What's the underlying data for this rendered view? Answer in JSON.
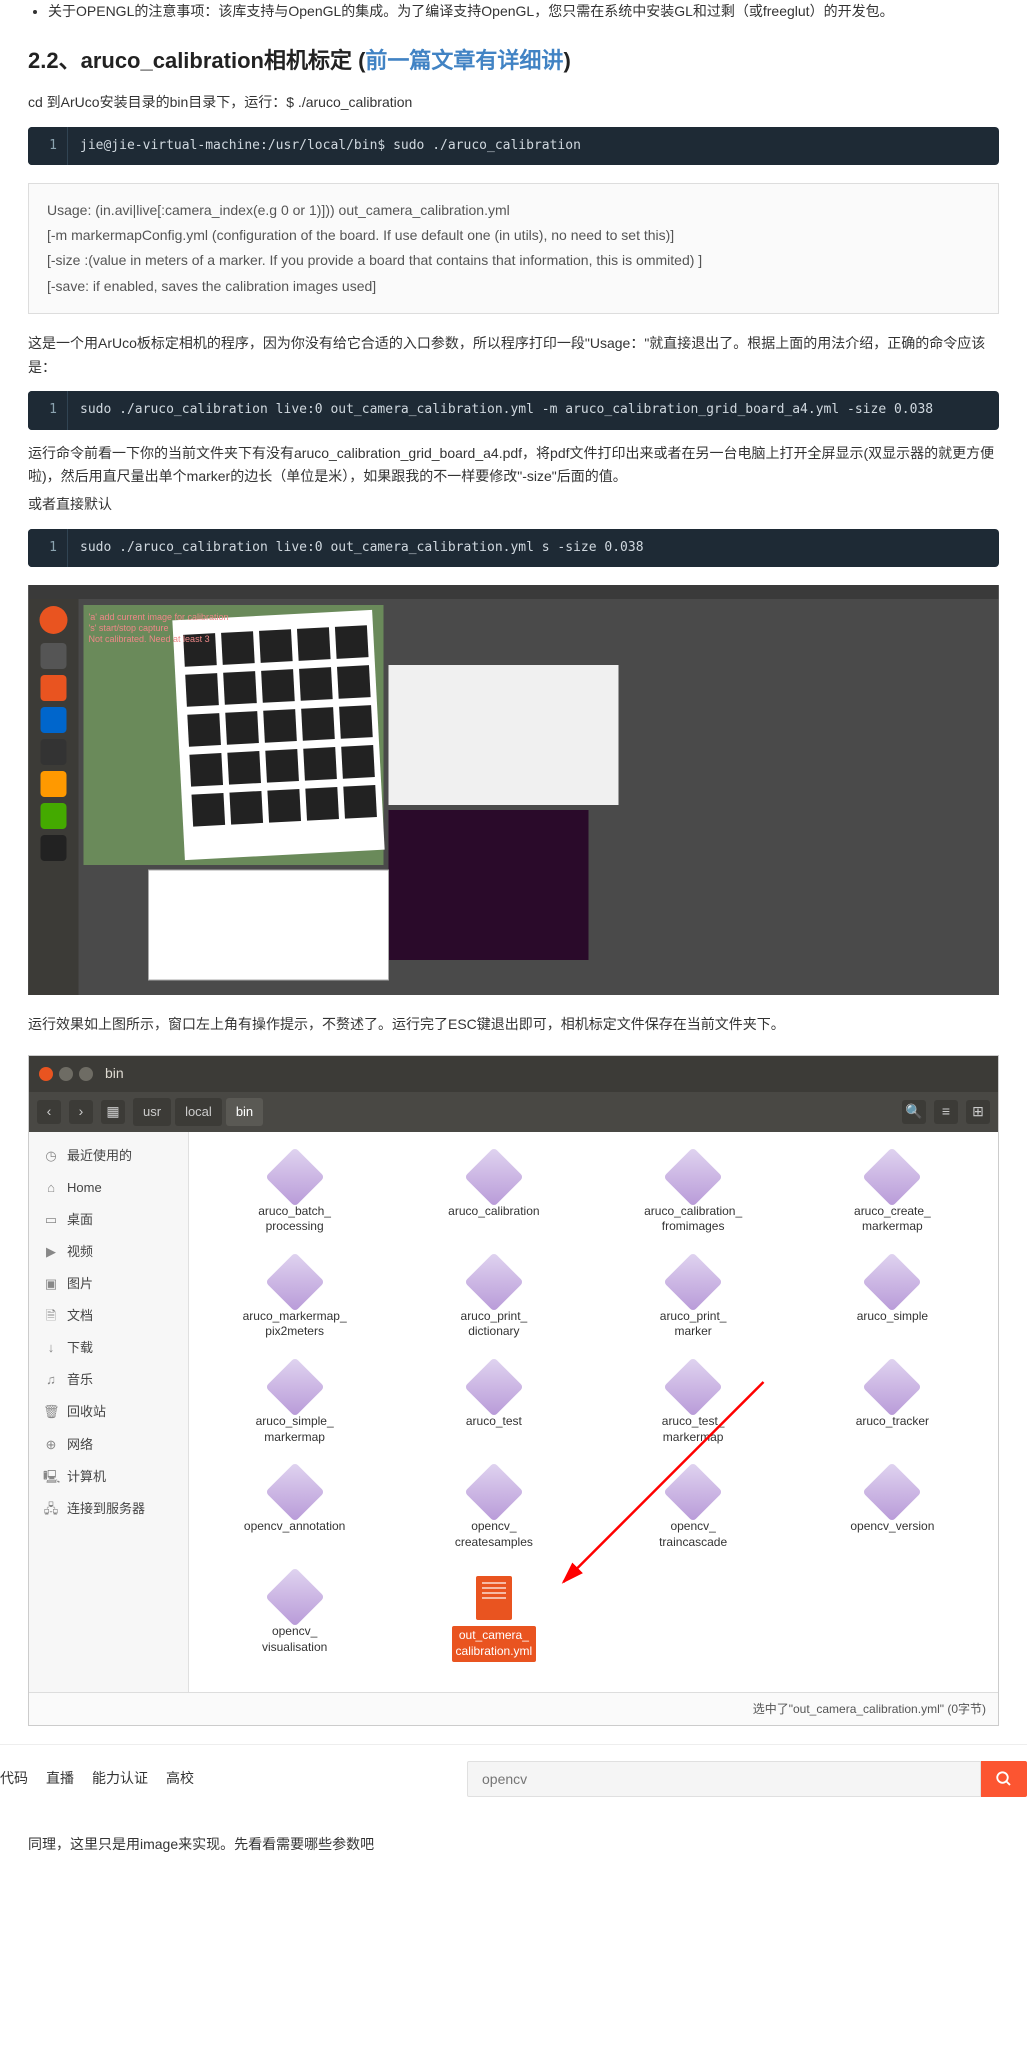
{
  "bullet_opengl": "关于OPENGL的注意事项：该库支持与OpenGL的集成。为了编译支持OpenGL，您只需在系统中安装GL和过剩（或freeglut）的开发包。",
  "h2_prefix": "2.2、aruco_calibration相机标定 (",
  "h2_link": "前一篇文章有详细讲",
  "h2_suffix": ")",
  "p_cd": "cd 到ArUco安装目录的bin目录下，运行：$ ./aruco_calibration",
  "code1": "jie@jie-virtual-machine:/usr/local/bin$ sudo ./aruco_calibration",
  "usage": {
    "l1": "Usage: (in.avi|live[:camera_index(e.g 0 or 1)])) out_camera_calibration.yml",
    "l2": "[-m markermapConfig.yml (configuration of the board. If use default one (in utils), no need to set this)]",
    "l3": "[-size :(value in meters of a marker. If you provide a board that contains that information, this is ommited) ]",
    "l4": "[-save: if enabled, saves the calibration images used]"
  },
  "p_explain": "这是一个用ArUco板标定相机的程序，因为你没有给它合适的入口参数，所以程序打印一段\"Usage：\"就直接退出了。根据上面的用法介绍，正确的命令应该是：",
  "code2": "sudo ./aruco_calibration live:0 out_camera_calibration.yml -m aruco_calibration_grid_board_a4.yml -size 0.038",
  "p_run": "运行命令前看一下你的当前文件夹下有没有aruco_calibration_grid_board_a4.pdf，将pdf文件打印出来或者在另一台电脑上打开全屏显示(双显示器的就更方便啦)，然后用直尺量出单个marker的边长（单位是米），如果跟我的不一样要修改\"-size\"后面的值。",
  "p_or": "或者直接默认",
  "code3": "sudo ./aruco_calibration live:0 out_camera_calibration.yml s -size 0.038",
  "p_result": "运行效果如上图所示，窗口左上角有操作提示，不赘述了。运行完了ESC键退出即可，相机标定文件保存在当前文件夹下。",
  "fm": {
    "title": "bin",
    "crumbs": [
      "usr",
      "local",
      "bin"
    ],
    "sidebar": [
      "最近使用的",
      "Home",
      "桌面",
      "视频",
      "图片",
      "文档",
      "下载",
      "音乐",
      "回收站",
      "网络",
      "计算机",
      "连接到服务器"
    ],
    "sidebar_icons": [
      "◷",
      "⌂",
      "▭",
      "▶",
      "▣",
      "🗎",
      "↓",
      "♫",
      "🗑",
      "⊕",
      "🖳",
      "🖧"
    ],
    "files": [
      "aruco_batch_\nprocessing",
      "aruco_calibration",
      "aruco_calibration_\nfromimages",
      "aruco_create_\nmarkermap",
      "aruco_markermap_\npix2meters",
      "aruco_print_\ndictionary",
      "aruco_print_\nmarker",
      "aruco_simple",
      "aruco_simple_\nmarkermap",
      "aruco_test",
      "aruco_test_\nmarkermap",
      "aruco_tracker",
      "opencv_annotation",
      "opencv_\ncreatesamples",
      "opencv_\ntraincascade",
      "opencv_version",
      "opencv_\nvisualisation",
      "out_camera_\ncalibration.yml"
    ],
    "status": "选中了\"out_camera_calibration.yml\" (0字节)"
  },
  "bottom": {
    "tabs": [
      "代码",
      "直播",
      "能力认证",
      "高校"
    ],
    "placeholder": "opencv"
  },
  "p_same": "同理，这里只是用image来实现。先看看需要哪些参数吧",
  "gutter": "1"
}
